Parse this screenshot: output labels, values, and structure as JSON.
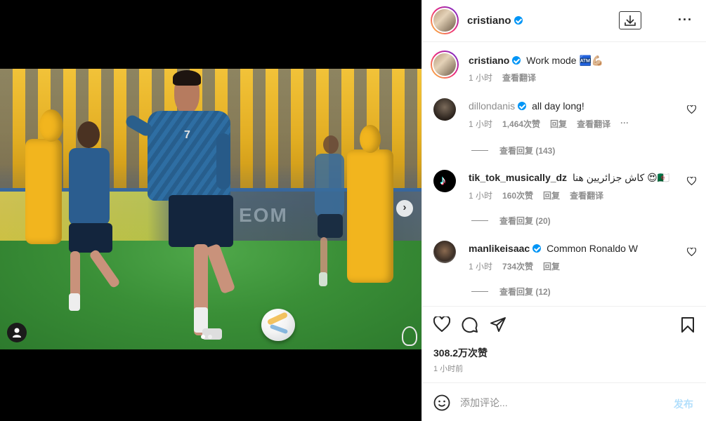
{
  "post": {
    "author": "cristiano",
    "caption_author": "cristiano",
    "caption_text": "Work mode 🏧💪🏼",
    "caption_time": "1 小时",
    "caption_translate": "查看翻译",
    "likes": "308.2万次赞",
    "time": "1 小时前"
  },
  "media": {
    "shirt_number": "7",
    "banner_text": "EOM",
    "carousel_dots": 2
  },
  "comments": [
    {
      "user": "dillondanis",
      "text": "all day long!",
      "time": "1 小时",
      "likes": "1,464次赞",
      "reply": "回复",
      "translate": "查看翻译",
      "replies": "查看回复 (143)"
    },
    {
      "user": "tik_tok_musically_dz",
      "text": "كاش جزائريين هنا 😍🇩🇿",
      "time": "1 小时",
      "likes": "160次赞",
      "reply": "回复",
      "translate": "查看翻译",
      "replies": "查看回复 (20)"
    },
    {
      "user": "manlikeisaac",
      "text": "Common Ronaldo W",
      "time": "1 小时",
      "likes": "734次赞",
      "reply": "回复",
      "replies": "查看回复 (12)"
    }
  ],
  "composer": {
    "placeholder": "添加评论...",
    "post_label": "发布"
  },
  "colors": {
    "verified": "#0095f6",
    "muted_text": "#8e8e8e",
    "post_disabled": "#b2dffc"
  },
  "icons": [
    "download-icon",
    "more-icon",
    "heart-icon",
    "comment-icon",
    "share-icon",
    "bookmark-icon",
    "emoji-icon",
    "chevron-right-icon",
    "user-tag-icon"
  ]
}
